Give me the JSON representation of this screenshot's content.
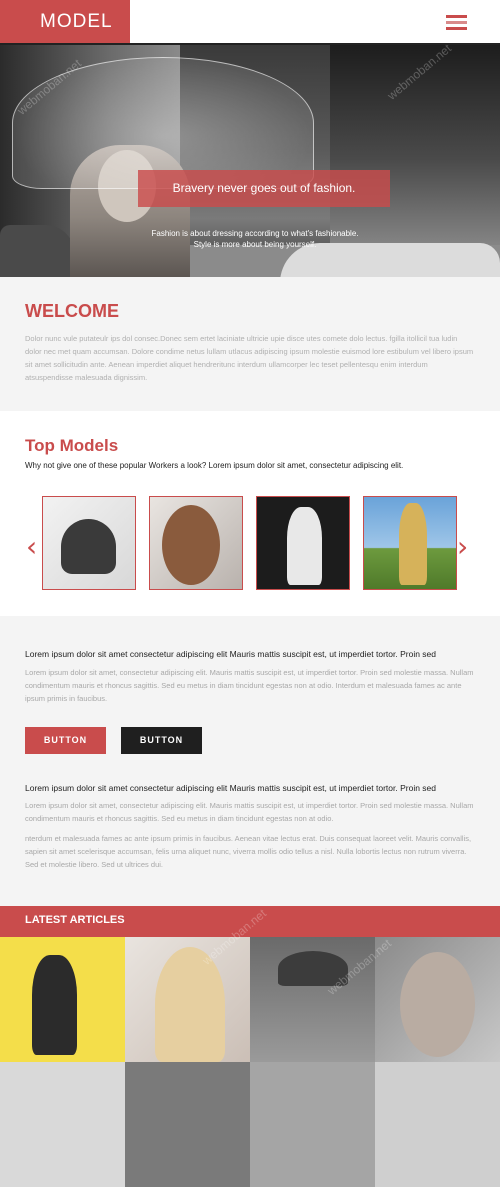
{
  "header": {
    "logo": "MODEL",
    "menu_icon": "hamburger-menu-icon"
  },
  "hero": {
    "tagline": "Bravery never goes out of fashion.",
    "subtext_line1": "Fashion is about dressing according to what's fashionable.",
    "subtext_line2": "Style is more about being yourself."
  },
  "welcome": {
    "title": "WELCOME",
    "body": "Dolor nunc vule putateulr ips dol consec.Donec sem ertet laciniate ultricie upie disce utes comete dolo lectus. fgilla itollicil tua ludin dolor nec met quam accumsan. Dolore condime netus lullam utlacus adipiscing ipsum molestie euismod lore estibulum vel libero ipsum sit amet sollicitudin ante. Aenean imperdiet aliquet hendreritunc interdum ullamcorper lec teset pellentesqu enim interdum atsuspendisse malesuada dignissim."
  },
  "top_models": {
    "title": "Top Models",
    "intro": "Why not give one of these popular Workers a look? Lorem ipsum dolor sit amet, consectetur adipiscing elit.",
    "prev_icon": "chevron-left-icon",
    "next_icon": "chevron-right-icon"
  },
  "content": {
    "lead1": "Lorem ipsum dolor sit amet consectetur adipiscing elit Mauris mattis suscipit est, ut imperdiet tortor. Proin sed",
    "body1": "Lorem ipsum dolor sit amet, consectetur adipiscing elit. Mauris mattis suscipit est, ut imperdiet tortor. Proin sed molestie massa. Nullam condimentum mauris et rhoncus sagittis. Sed eu metus in diam tincidunt egestas non at odio. Interdum et malesuada fames ac ante ipsum primis in faucibus.",
    "button_red": "BUTTON",
    "button_dark": "BUTTON",
    "lead2": "Lorem ipsum dolor sit amet consectetur adipiscing elit Mauris mattis suscipit est, ut imperdiet tortor. Proin sed",
    "body2": "Lorem ipsum dolor sit amet, consectetur adipiscing elit. Mauris mattis suscipit est, ut imperdiet tortor. Proin sed molestie massa. Nullam condimentum mauris et rhoncus sagittis. Sed eu metus in diam tincidunt egestas non at odio.",
    "body3": "nterdum et malesuada fames ac ante ipsum primis in faucibus. Aenean vitae lectus erat. Duis consequat laoreet velit. Mauris convallis, sapien sit amet scelerisque accumsan, felis urna aliquet nunc, viverra mollis odio tellus a nisl. Nulla lobortis lectus non rutrum viverra. Sed et molestie libero. Sed ut ultrices dui."
  },
  "articles": {
    "title": "LATEST ARTICLES"
  },
  "watermark": "webmoban.net",
  "colors": {
    "accent": "#c94c4c",
    "dark": "#1f1f1f",
    "section_bg": "#f4f4f4"
  }
}
